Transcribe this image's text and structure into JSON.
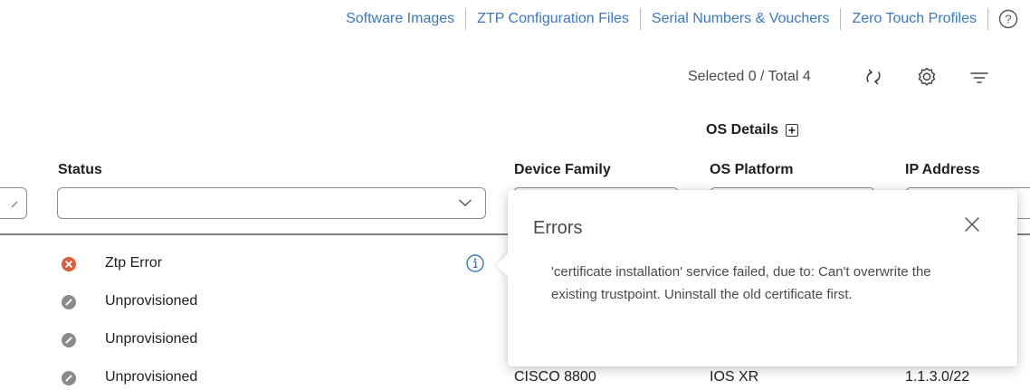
{
  "nav": {
    "links": [
      "Software Images",
      "ZTP Configuration Files",
      "Serial Numbers & Vouchers",
      "Zero Touch Profiles"
    ],
    "help_icon": "question-circle-icon"
  },
  "toolbar": {
    "selection_text": "Selected 0 / Total 4",
    "icons": [
      "refresh-icon",
      "gear-icon",
      "filter-lines-icon"
    ]
  },
  "table": {
    "group_header": "OS Details",
    "group_toggle_icon": "plus-square-icon",
    "columns": {
      "status": "Status",
      "device_family": "Device Family",
      "os_platform": "OS Platform",
      "ip_address": "IP Address"
    },
    "status_filter_value": "",
    "rows": [
      {
        "status": "Ztp Error",
        "status_icon": "error-circle-icon",
        "device_family": "",
        "os_platform": "",
        "ip_address": ""
      },
      {
        "status": "Unprovisioned",
        "status_icon": "slash-circle-icon",
        "device_family": "",
        "os_platform": "",
        "ip_address": ""
      },
      {
        "status": "Unprovisioned",
        "status_icon": "slash-circle-icon",
        "device_family": "",
        "os_platform": "",
        "ip_address": ""
      },
      {
        "status": "Unprovisioned",
        "status_icon": "slash-circle-icon",
        "device_family": "CISCO 8800",
        "os_platform": "IOS XR",
        "ip_address": "1.1.3.0/22"
      }
    ]
  },
  "popover": {
    "title": "Errors",
    "message": "'certificate installation' service failed, due to: Can't overwrite the existing trustpoint. Uninstall the old certificate first."
  },
  "colors": {
    "link": "#3a78c3",
    "error": "#e0593a",
    "unprovisioned": "#8a8a8a",
    "info": "#3a78c3"
  }
}
